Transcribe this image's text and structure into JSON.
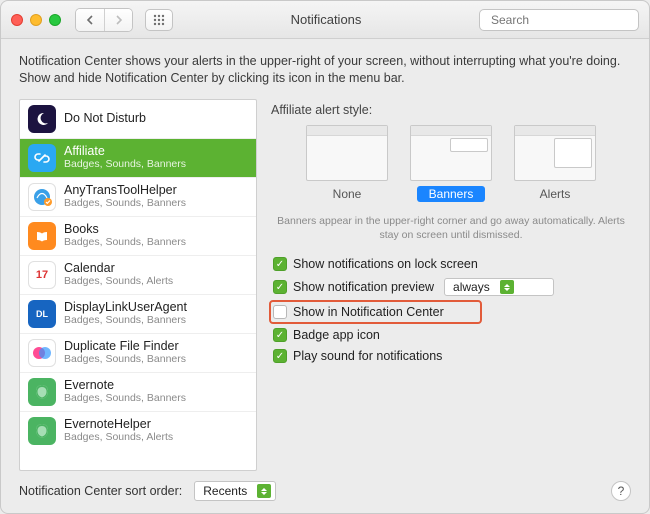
{
  "titlebar": {
    "title": "Notifications",
    "search_placeholder": "Search"
  },
  "intro": "Notification Center shows your alerts in the upper-right of your screen, without interrupting what you're doing. Show and hide Notification Center by clicking its icon in the menu bar.",
  "apps": [
    {
      "name": "Do Not Disturb",
      "sub": "",
      "icon": "moon"
    },
    {
      "name": "Affiliate",
      "sub": "Badges, Sounds, Banners",
      "icon": "link",
      "selected": true
    },
    {
      "name": "AnyTransToolHelper",
      "sub": "Badges, Sounds, Banners",
      "icon": "any"
    },
    {
      "name": "Books",
      "sub": "Badges, Sounds, Banners",
      "icon": "books"
    },
    {
      "name": "Calendar",
      "sub": "Badges, Sounds, Alerts",
      "icon": "cal",
      "cal_day": "17"
    },
    {
      "name": "DisplayLinkUserAgent",
      "sub": "Badges, Sounds, Banners",
      "icon": "dl"
    },
    {
      "name": "Duplicate File Finder",
      "sub": "Badges, Sounds, Banners",
      "icon": "dup"
    },
    {
      "name": "Evernote",
      "sub": "Badges, Sounds, Banners",
      "icon": "ev"
    },
    {
      "name": "EvernoteHelper",
      "sub": "Badges, Sounds, Alerts",
      "icon": "ev"
    }
  ],
  "detail": {
    "style_heading": "Affiliate alert style:",
    "styles": [
      {
        "label": "None"
      },
      {
        "label": "Banners",
        "selected": true
      },
      {
        "label": "Alerts"
      }
    ],
    "style_note": "Banners appear in the upper-right corner and go away automatically. Alerts stay on screen until dismissed.",
    "checks": [
      {
        "label": "Show notifications on lock screen",
        "checked": true
      },
      {
        "label": "Show notification preview",
        "checked": true,
        "popup": "always"
      },
      {
        "label": "Show in Notification Center",
        "checked": false,
        "highlight": true
      },
      {
        "label": "Badge app icon",
        "checked": true
      },
      {
        "label": "Play sound for notifications",
        "checked": true
      }
    ]
  },
  "footer": {
    "sort_label": "Notification Center sort order:",
    "sort_value": "Recents"
  }
}
